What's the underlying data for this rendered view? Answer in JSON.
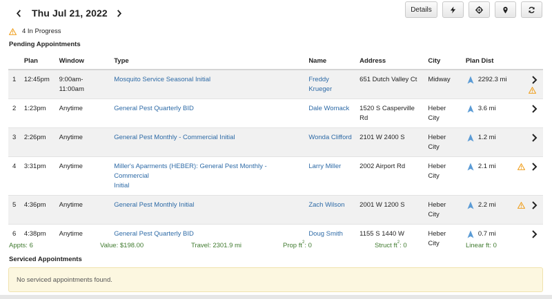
{
  "header": {
    "date": "Thu Jul 21, 2022",
    "details_label": "Details"
  },
  "status": {
    "in_progress": "4 In Progress"
  },
  "pending": {
    "title": "Pending Appointments",
    "columns": [
      "",
      "Plan",
      "Window",
      "Type",
      "Name",
      "Address",
      "City",
      "Plan Dist",
      ""
    ],
    "rows": [
      {
        "num": "1",
        "plan": "12:45pm",
        "window": "9:00am-\n11:00am",
        "type": "Mosquito Service Seasonal Initial",
        "name": "Freddy\nKrueger",
        "address": "651 Dutch Valley Ct",
        "city": "Midway",
        "dist": "2292.3 mi",
        "warn": "below"
      },
      {
        "num": "2",
        "plan": "1:23pm",
        "window": "Anytime",
        "type": "General Pest Quarterly BID",
        "name": "Dale Womack",
        "address": "1520 S Casperville\nRd",
        "city": "Heber\nCity",
        "dist": "3.6 mi",
        "warn": ""
      },
      {
        "num": "3",
        "plan": "2:26pm",
        "window": "Anytime",
        "type": "General Pest Monthly - Commercial Initial",
        "name": "Wonda Clifford",
        "address": "2101 W 2400 S",
        "city": "Heber\nCity",
        "dist": "1.2 mi",
        "warn": ""
      },
      {
        "num": "4",
        "plan": "3:31pm",
        "window": "Anytime",
        "type": "Miller's Aparments (HEBER): General Pest Monthly - Commercial\nInitial",
        "name": "Larry Miller",
        "address": "2002 Airport Rd",
        "city": "Heber\nCity",
        "dist": "2.1 mi",
        "warn": "inline"
      },
      {
        "num": "5",
        "plan": "4:36pm",
        "window": "Anytime",
        "type": "General Pest Monthly Initial",
        "name": "Zach Wilson",
        "address": "2001 W 1200 S",
        "city": "Heber\nCity",
        "dist": "2.2 mi",
        "warn": "inline"
      },
      {
        "num": "6",
        "plan": "4:38pm",
        "window": "Anytime",
        "type": "General Pest Quarterly BID",
        "name": "Doug Smith",
        "address": "1155 S 1440 W",
        "city": "Heber\nCity",
        "dist": "0.7 mi",
        "warn": ""
      }
    ]
  },
  "totals": {
    "appts": "Appts: 6",
    "value": "Value: $198.00",
    "travel": "Travel: 2301.9 mi",
    "prop_label": "Prop ft",
    "prop_value": ": 0",
    "struct_label": "Struct ft",
    "struct_value": ": 0",
    "sup": "2",
    "linear": "Linear ft: 0"
  },
  "serviced": {
    "title": "Serviced Appointments",
    "empty": "No serviced appointments found."
  },
  "colors": {
    "link": "#2d6aa6",
    "totals": "#3f7a2e",
    "warn": "#f0a020",
    "pin": "#5b9bd5",
    "notice_bg": "#fcf7e0"
  },
  "icons": {
    "prev": "chevron-left-icon",
    "next": "chevron-right-icon",
    "toolbar": [
      "lightning-icon",
      "crosshair-icon",
      "map-pin-icon",
      "refresh-icon"
    ],
    "warning": "warning-icon",
    "location": "navigation-arrow-icon",
    "row_open": "chevron-right-icon"
  }
}
